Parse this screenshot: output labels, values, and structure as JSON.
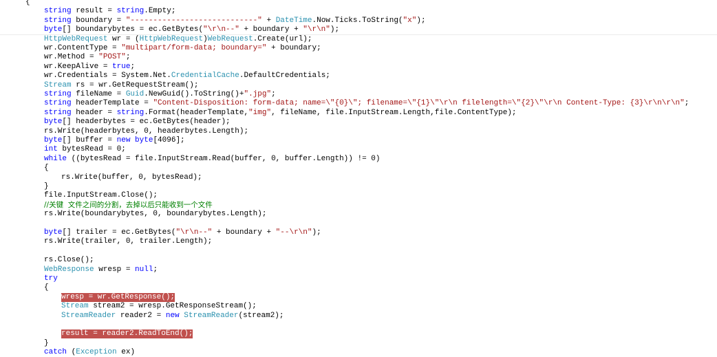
{
  "editor": {
    "language": "C#",
    "colors": {
      "background": "#ffffff",
      "keyword": "#0000ff",
      "type": "#2b91af",
      "string": "#a31515",
      "comment": "#008000",
      "highlight": "#c0504d"
    },
    "lines": [
      {
        "indent": 0,
        "tokens": [
          [
            "p",
            "{"
          ]
        ]
      },
      {
        "indent": 1,
        "tokens": [
          [
            "k",
            "string"
          ],
          [
            "p",
            " result = "
          ],
          [
            "k",
            "string"
          ],
          [
            "p",
            ".Empty;"
          ]
        ]
      },
      {
        "indent": 1,
        "tokens": [
          [
            "k",
            "string"
          ],
          [
            "p",
            " boundary = "
          ],
          [
            "s",
            "\"----------------------------\""
          ],
          [
            "p",
            " + "
          ],
          [
            "t",
            "DateTime"
          ],
          [
            "p",
            ".Now.Ticks.ToString("
          ],
          [
            "s",
            "\"x\""
          ],
          [
            "p",
            ");"
          ]
        ]
      },
      {
        "indent": 1,
        "tokens": [
          [
            "k",
            "byte"
          ],
          [
            "p",
            "[] boundarybytes = ec.GetBytes("
          ],
          [
            "s",
            "\"\\r\\n--\""
          ],
          [
            "p",
            " + boundary + "
          ],
          [
            "s",
            "\"\\r\\n\""
          ],
          [
            "p",
            ");"
          ]
        ],
        "sep": true
      },
      {
        "indent": 1,
        "tokens": [
          [
            "t",
            "HttpWebRequest"
          ],
          [
            "p",
            " wr = ("
          ],
          [
            "t",
            "HttpWebRequest"
          ],
          [
            "p",
            ")"
          ],
          [
            "t",
            "WebRequest"
          ],
          [
            "p",
            ".Create(url);"
          ]
        ]
      },
      {
        "indent": 1,
        "tokens": [
          [
            "p",
            "wr.ContentType = "
          ],
          [
            "s",
            "\"multipart/form-data; boundary=\""
          ],
          [
            "p",
            " + boundary;"
          ]
        ]
      },
      {
        "indent": 1,
        "tokens": [
          [
            "p",
            "wr.Method = "
          ],
          [
            "s",
            "\"POST\""
          ],
          [
            "p",
            ";"
          ]
        ]
      },
      {
        "indent": 1,
        "tokens": [
          [
            "p",
            "wr.KeepAlive = "
          ],
          [
            "k",
            "true"
          ],
          [
            "p",
            ";"
          ]
        ]
      },
      {
        "indent": 1,
        "tokens": [
          [
            "p",
            "wr.Credentials = System.Net."
          ],
          [
            "t",
            "CredentialCache"
          ],
          [
            "p",
            ".DefaultCredentials;"
          ]
        ]
      },
      {
        "indent": 1,
        "tokens": [
          [
            "t",
            "Stream"
          ],
          [
            "p",
            " rs = wr.GetRequestStream();"
          ]
        ]
      },
      {
        "indent": 1,
        "tokens": [
          [
            "k",
            "string"
          ],
          [
            "p",
            " fileName = "
          ],
          [
            "t",
            "Guid"
          ],
          [
            "p",
            ".NewGuid().ToString()+"
          ],
          [
            "s",
            "\".jpg\""
          ],
          [
            "p",
            ";"
          ]
        ]
      },
      {
        "indent": 1,
        "tokens": [
          [
            "k",
            "string"
          ],
          [
            "p",
            " headerTemplate = "
          ],
          [
            "s",
            "\"Content-Disposition: form-data; name=\\\"{0}\\\"; filename=\\\"{1}\\\"\\r\\n filelength=\\\"{2}\\\"\\r\\n Content-Type: {3}\\r\\n\\r\\n\""
          ],
          [
            "p",
            ";"
          ]
        ]
      },
      {
        "indent": 1,
        "tokens": [
          [
            "k",
            "string"
          ],
          [
            "p",
            " header = "
          ],
          [
            "k",
            "string"
          ],
          [
            "p",
            ".Format(headerTemplate,"
          ],
          [
            "s",
            "\"img\""
          ],
          [
            "p",
            ", fileName, file.InputStream.Length,file.ContentType);"
          ]
        ]
      },
      {
        "indent": 1,
        "tokens": [
          [
            "k",
            "byte"
          ],
          [
            "p",
            "[] headerbytes = ec.GetBytes(header);"
          ]
        ]
      },
      {
        "indent": 1,
        "tokens": [
          [
            "p",
            "rs.Write(headerbytes, 0, headerbytes.Length);"
          ]
        ]
      },
      {
        "indent": 1,
        "tokens": [
          [
            "k",
            "byte"
          ],
          [
            "p",
            "[] buffer = "
          ],
          [
            "k",
            "new"
          ],
          [
            "p",
            " "
          ],
          [
            "k",
            "byte"
          ],
          [
            "p",
            "[4096];"
          ]
        ]
      },
      {
        "indent": 1,
        "tokens": [
          [
            "k",
            "int"
          ],
          [
            "p",
            " bytesRead = 0;"
          ]
        ]
      },
      {
        "indent": 1,
        "tokens": [
          [
            "k",
            "while"
          ],
          [
            "p",
            " ((bytesRead = file.InputStream.Read(buffer, 0, buffer.Length)) != 0)"
          ]
        ]
      },
      {
        "indent": 1,
        "tokens": [
          [
            "p",
            "{"
          ]
        ]
      },
      {
        "indent": 2,
        "tokens": [
          [
            "p",
            "rs.Write(buffer, 0, bytesRead);"
          ]
        ]
      },
      {
        "indent": 1,
        "tokens": [
          [
            "p",
            "}"
          ]
        ]
      },
      {
        "indent": 1,
        "tokens": [
          [
            "p",
            "file.InputStream.Close();"
          ]
        ]
      },
      {
        "indent": 1,
        "tokens": [
          [
            "c",
            "//关键  文件之间的分割，去掉以后只能收到一个文件"
          ]
        ]
      },
      {
        "indent": 1,
        "tokens": [
          [
            "p",
            "rs.Write(boundarybytes, 0, boundarybytes.Length);"
          ]
        ]
      },
      {
        "indent": 1,
        "tokens": []
      },
      {
        "indent": 1,
        "tokens": [
          [
            "k",
            "byte"
          ],
          [
            "p",
            "[] trailer = ec.GetBytes("
          ],
          [
            "s",
            "\"\\r\\n--\""
          ],
          [
            "p",
            " + boundary + "
          ],
          [
            "s",
            "\"--\\r\\n\""
          ],
          [
            "p",
            ");"
          ]
        ]
      },
      {
        "indent": 1,
        "tokens": [
          [
            "p",
            "rs.Write(trailer, 0, trailer.Length);"
          ]
        ]
      },
      {
        "indent": 1,
        "tokens": []
      },
      {
        "indent": 1,
        "tokens": [
          [
            "p",
            "rs.Close();"
          ]
        ]
      },
      {
        "indent": 1,
        "tokens": [
          [
            "t",
            "WebResponse"
          ],
          [
            "p",
            " wresp = "
          ],
          [
            "k",
            "null"
          ],
          [
            "p",
            ";"
          ]
        ]
      },
      {
        "indent": 1,
        "tokens": [
          [
            "k",
            "try"
          ]
        ]
      },
      {
        "indent": 1,
        "tokens": [
          [
            "p",
            "{"
          ]
        ]
      },
      {
        "indent": 2,
        "tokens": [
          [
            "p",
            "wresp = wr.GetResponse();"
          ]
        ],
        "highlight": true
      },
      {
        "indent": 2,
        "tokens": [
          [
            "t",
            "Stream"
          ],
          [
            "p",
            " stream2 = wresp.GetResponseStream();"
          ]
        ]
      },
      {
        "indent": 2,
        "tokens": [
          [
            "t",
            "StreamReader"
          ],
          [
            "p",
            " reader2 = "
          ],
          [
            "k",
            "new"
          ],
          [
            "p",
            " "
          ],
          [
            "t",
            "StreamReader"
          ],
          [
            "p",
            "(stream2);"
          ]
        ]
      },
      {
        "indent": 2,
        "tokens": []
      },
      {
        "indent": 2,
        "tokens": [
          [
            "p",
            "result = reader2.ReadToEnd();"
          ]
        ],
        "highlight": true
      },
      {
        "indent": 1,
        "tokens": [
          [
            "p",
            "}"
          ]
        ]
      },
      {
        "indent": 1,
        "tokens": [
          [
            "k",
            "catch"
          ],
          [
            "p",
            " ("
          ],
          [
            "t",
            "Exception"
          ],
          [
            "p",
            " ex)"
          ]
        ]
      }
    ]
  }
}
